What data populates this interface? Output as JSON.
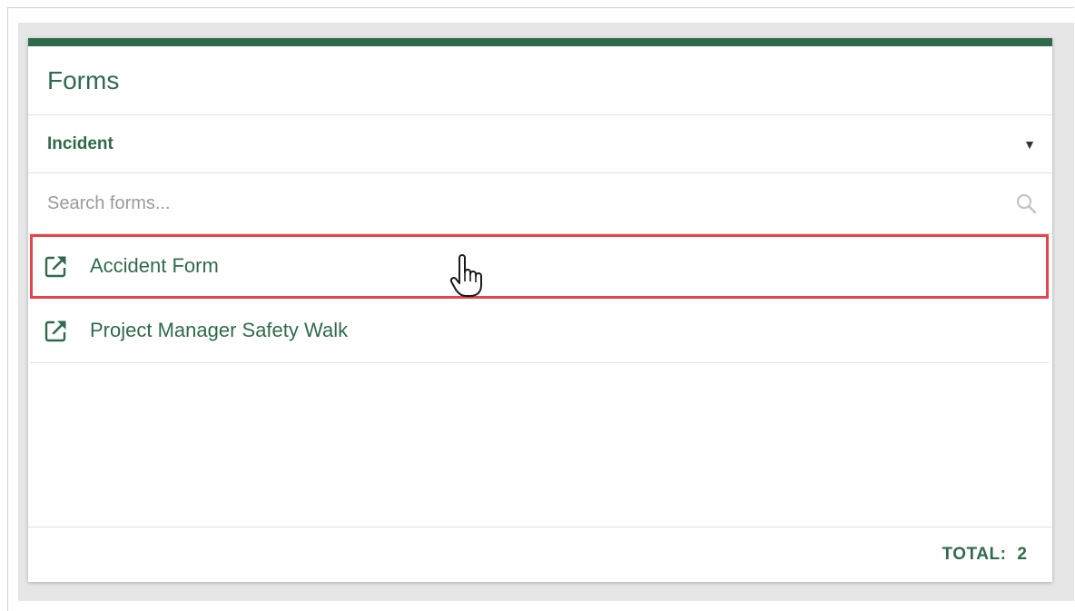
{
  "colors": {
    "accent": "#2f6b4b",
    "highlight": "#e8434b"
  },
  "card": {
    "title": "Forms"
  },
  "category": {
    "selected": "Incident",
    "caret_icon": "caret-down-icon"
  },
  "search": {
    "placeholder": "Search forms...",
    "value": "",
    "icon": "search-icon"
  },
  "forms": [
    {
      "label": "Accident Form",
      "icon": "external-link-icon",
      "highlighted": true
    },
    {
      "label": "Project Manager Safety Walk",
      "icon": "external-link-icon",
      "highlighted": false
    }
  ],
  "footer": {
    "total_label": "TOTAL:",
    "total_value": "2"
  }
}
